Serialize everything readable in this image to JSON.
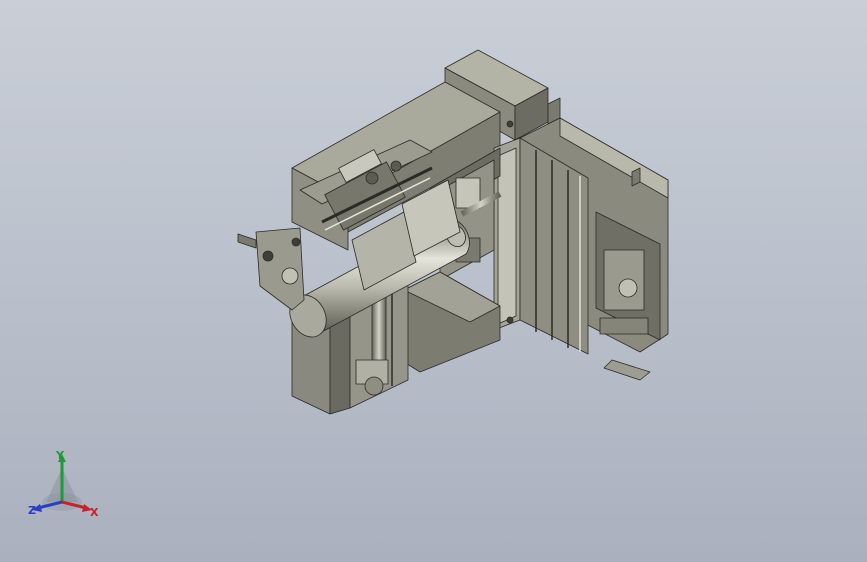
{
  "viewport": {
    "background_top": "#c9ced7",
    "background_bottom": "#aab0bd"
  },
  "model": {
    "body_color": "#8a8a7e",
    "highlight_color": "#b3b3a6",
    "shadow_color": "#5c5c52",
    "edge_color": "#2b2b26"
  },
  "triad": {
    "x_label": "X",
    "y_label": "Y",
    "z_label": "Z",
    "x_color": "#c4242a",
    "y_color": "#1e9a3a",
    "z_color": "#2a3fc4"
  }
}
